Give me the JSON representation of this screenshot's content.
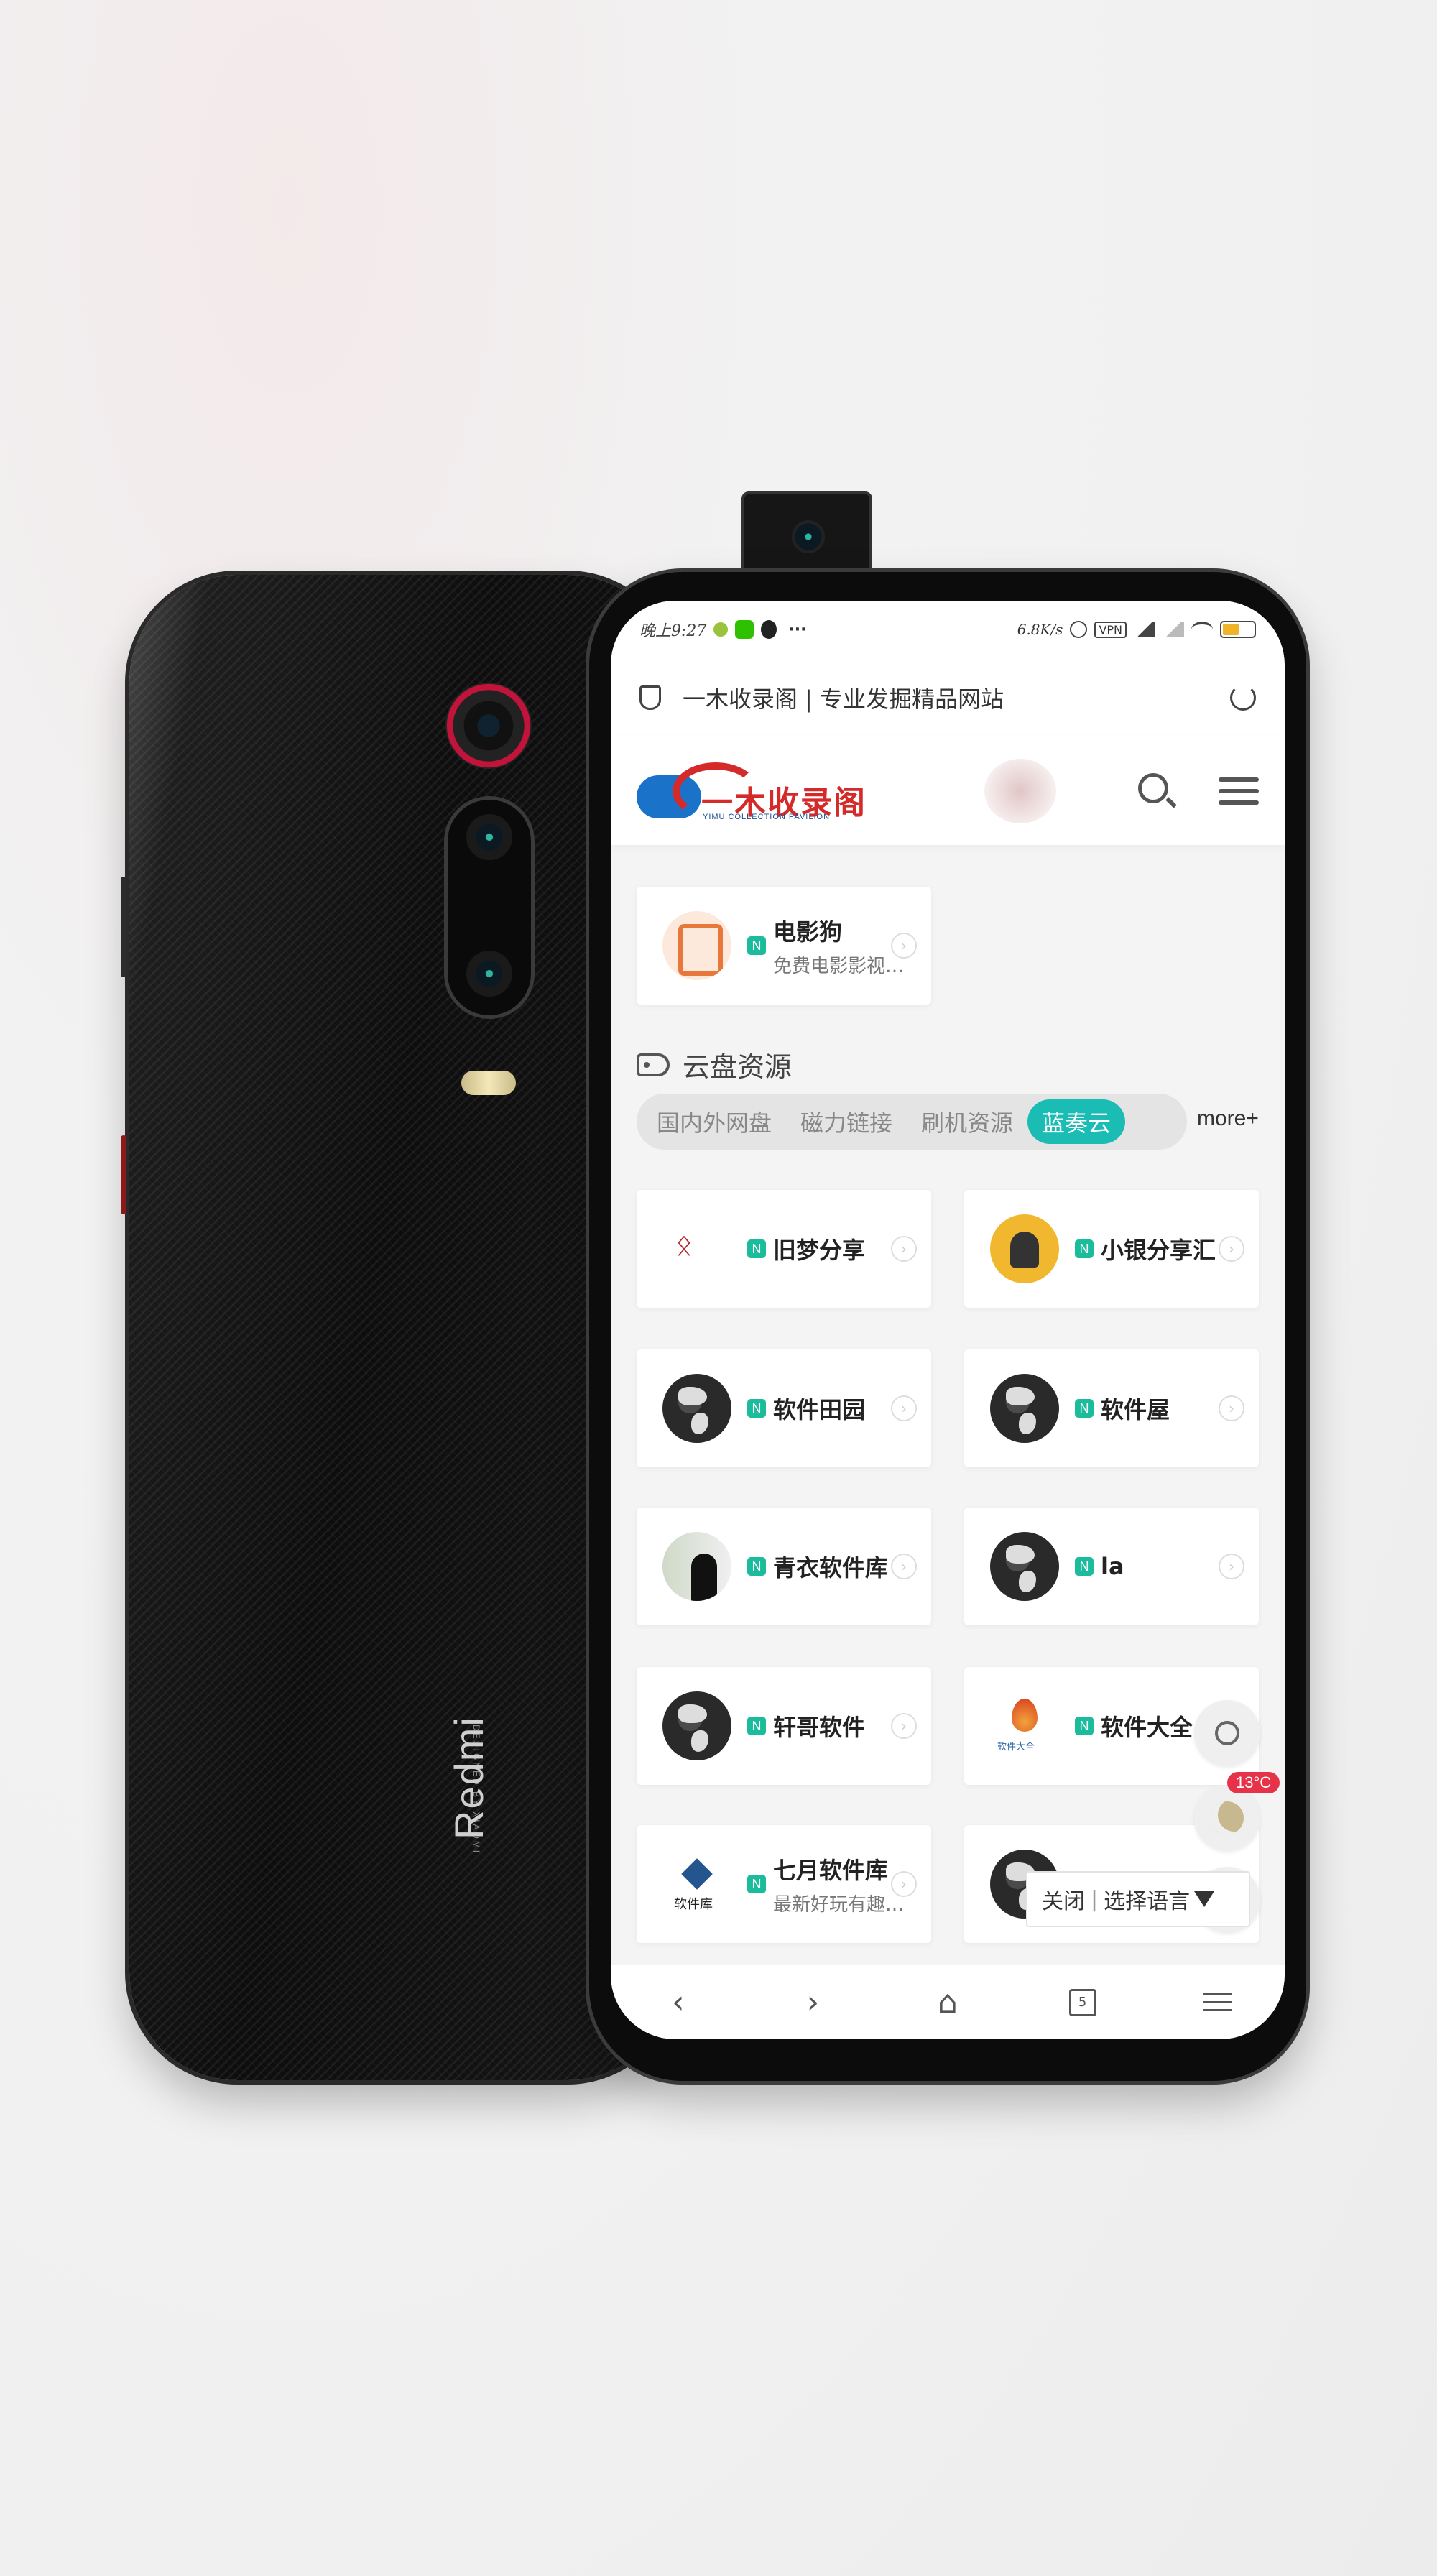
{
  "device": {
    "back_brand": "Redmi",
    "back_tagline": "DESIGNED BY XIAOMI"
  },
  "status_bar": {
    "time": "晚上9:27",
    "more": "···",
    "speed": "6.8K/s",
    "vpn": "VPN",
    "icons": [
      "leaf-icon",
      "wechat-icon",
      "qq-icon",
      "alarm-icon",
      "signal-icon",
      "wifi-icon",
      "battery-icon"
    ]
  },
  "url_bar": {
    "title": "一木收录阁 | 专业发掘精品网站"
  },
  "site_header": {
    "logo_text": "一木收录阁",
    "logo_subtext": "YIMU COLLECTION PAVILION"
  },
  "featured": {
    "name": "电影狗",
    "desc": "免费电影影视…",
    "badge": "N"
  },
  "section": {
    "title": "云盘资源",
    "tabs": [
      {
        "label": "国内外网盘",
        "active": false
      },
      {
        "label": "磁力链接",
        "active": false
      },
      {
        "label": "刷机资源",
        "active": false
      },
      {
        "label": "蓝奏云",
        "active": true
      }
    ],
    "more": "more+"
  },
  "cards": [
    {
      "name": "旧梦分享",
      "desc": "",
      "badge": "N",
      "avatar": "script-logo"
    },
    {
      "name": "小银分享汇",
      "desc": "",
      "badge": "N",
      "avatar": "yellow-avatar"
    },
    {
      "name": "软件田园",
      "desc": "",
      "badge": "N",
      "avatar": "globe-icon"
    },
    {
      "name": "软件屋",
      "desc": "",
      "badge": "N",
      "avatar": "globe-icon"
    },
    {
      "name": "青衣软件库",
      "desc": "",
      "badge": "N",
      "avatar": "person-photo"
    },
    {
      "name": "la",
      "desc": "",
      "badge": "N",
      "avatar": "globe-icon"
    },
    {
      "name": "轩哥软件",
      "desc": "",
      "badge": "N",
      "avatar": "globe-icon"
    },
    {
      "name": "软件大全",
      "desc": "",
      "badge": "N",
      "avatar": "flame-logo"
    },
    {
      "name": "七月软件库",
      "desc": "最新好玩有趣…",
      "badge": "N",
      "avatar": "library-logo"
    },
    {
      "name": "",
      "desc": "",
      "badge": "",
      "avatar": "globe-icon"
    }
  ],
  "floating": {
    "temperature": "13°C"
  },
  "language_bar": {
    "close": "关闭",
    "separator": "|",
    "select": "选择语言"
  },
  "bottom_nav": {
    "back": "‹",
    "forward": "›",
    "home": "⌂",
    "tab_count": "5"
  },
  "colors": {
    "accent": "#1bbcb4",
    "badge": "#1bbc9b",
    "temp_badge": "#e6334a",
    "logo_red": "#d42a2a"
  }
}
